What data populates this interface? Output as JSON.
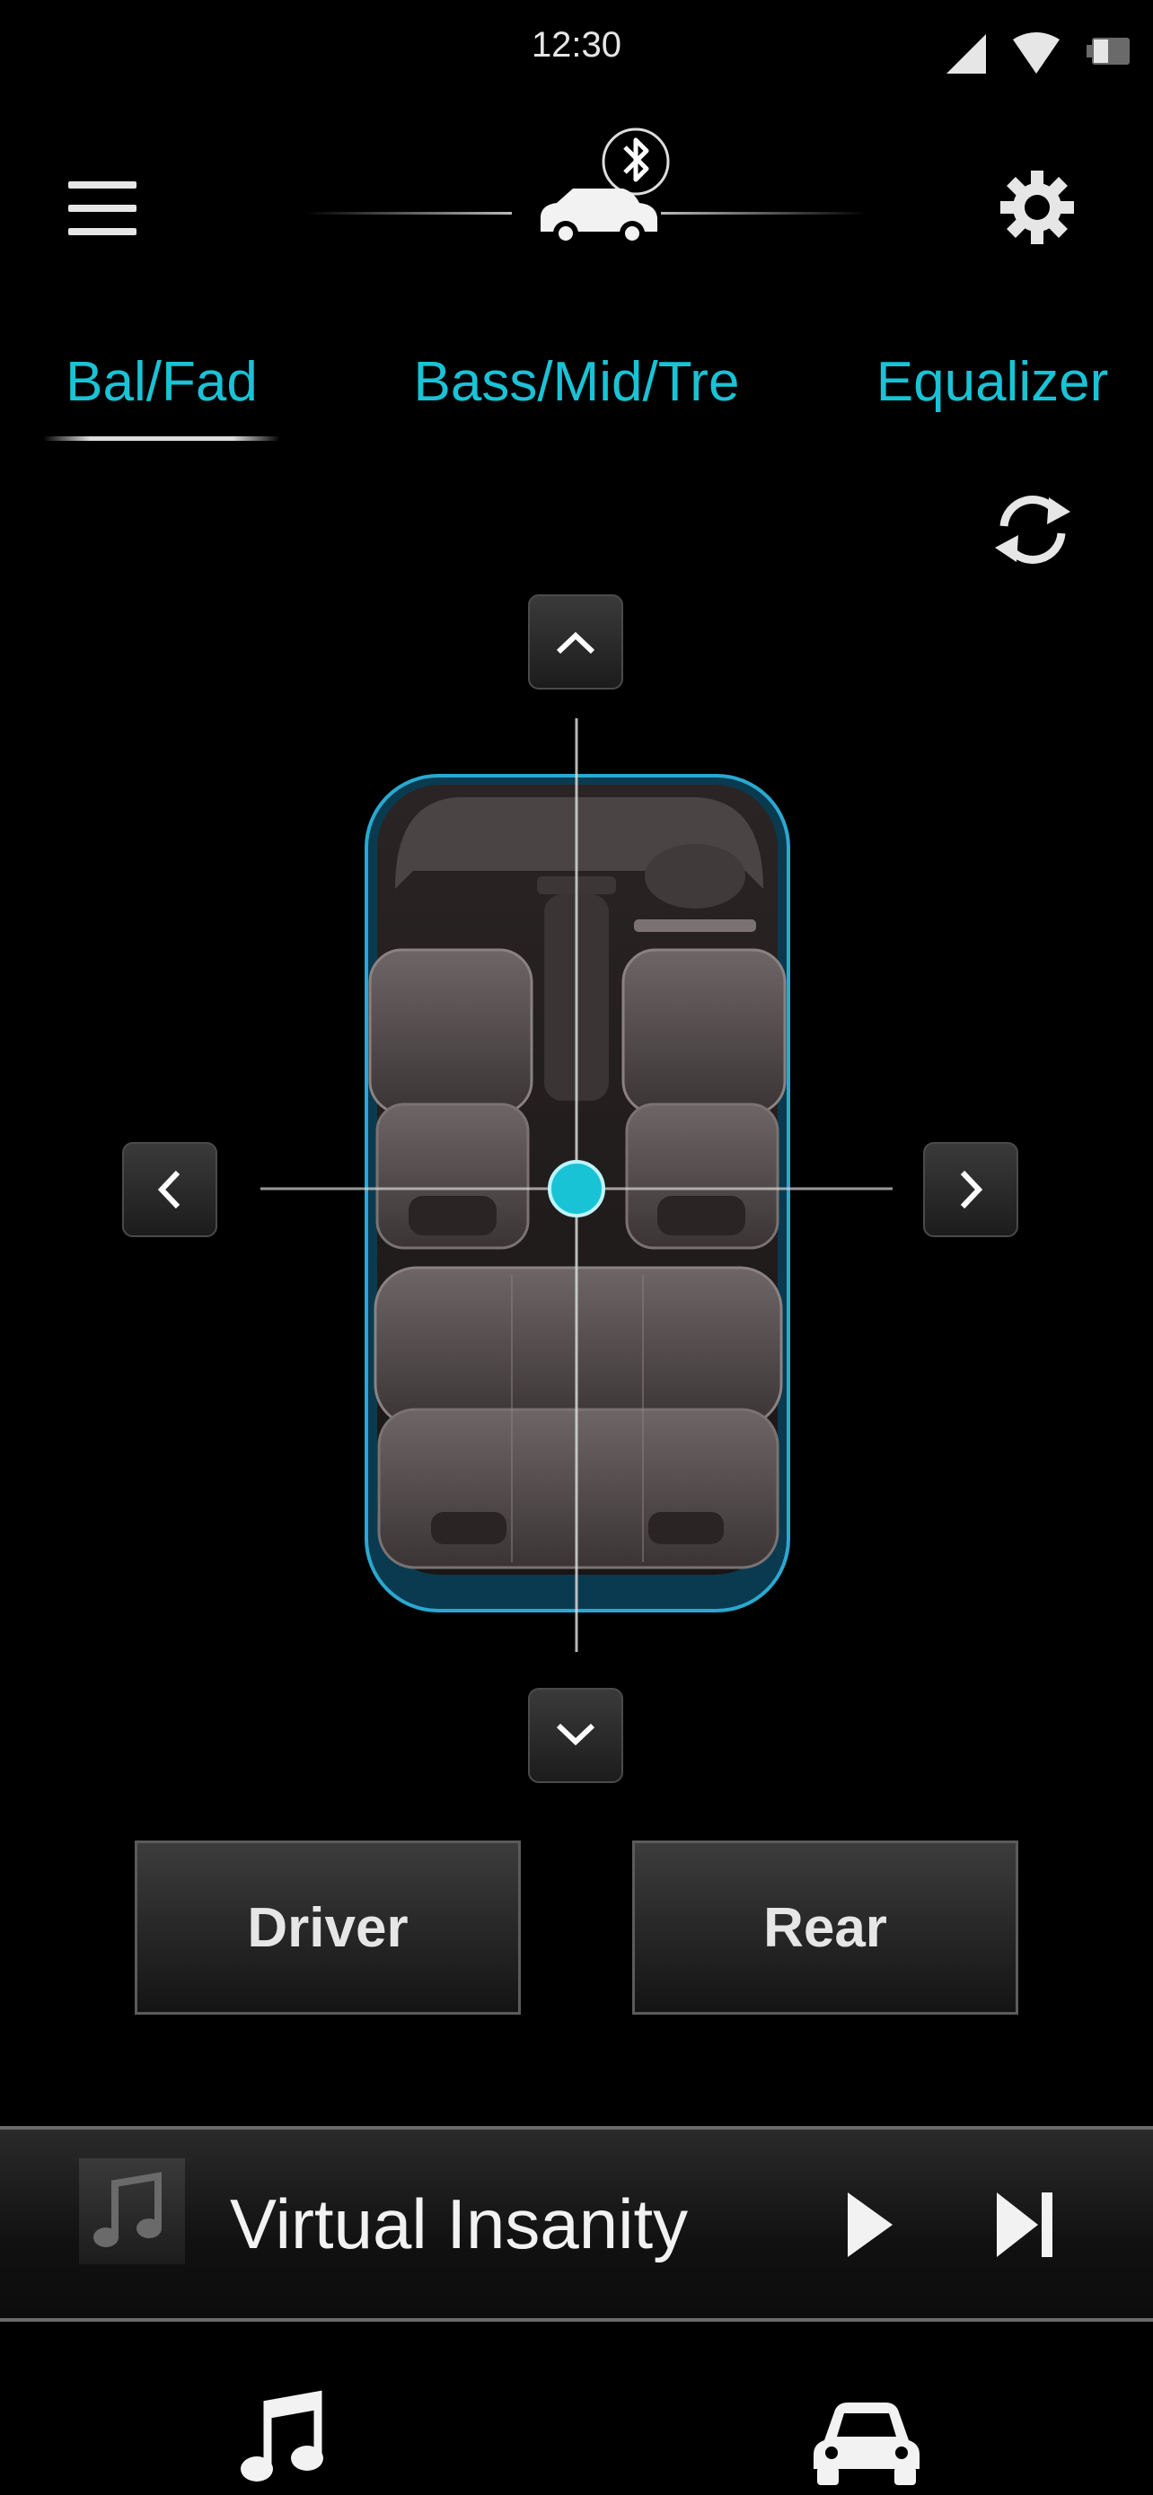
{
  "status_bar": {
    "time": "12:30"
  },
  "header": {
    "menu_icon": "hamburger-menu-icon",
    "car_icon": "car-bluetooth-icon",
    "settings_icon": "gear-icon"
  },
  "tabs": [
    {
      "label": "Bal/Fad",
      "active": true
    },
    {
      "label": "Bass/Mid/Tre",
      "active": false
    },
    {
      "label": "Equalizer",
      "active": false
    }
  ],
  "balance_fader": {
    "reset_icon": "reset-icon",
    "accent_color": "#19c3d6"
  },
  "buttons": {
    "driver": "Driver",
    "rear": "Rear"
  },
  "player": {
    "title": "Virtual Insanity"
  },
  "bottom_nav": {
    "music_icon": "music-note-icon",
    "car_icon": "car-icon"
  }
}
